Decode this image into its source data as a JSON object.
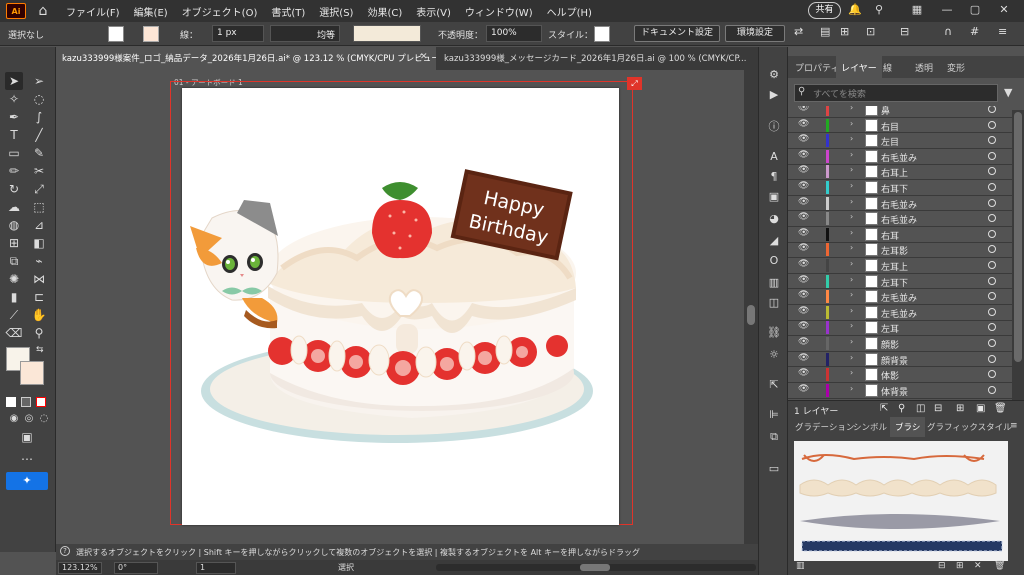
{
  "menubar": {
    "logo": "Ai",
    "items": [
      "ファイル(F)",
      "編集(E)",
      "オブジェクト(O)",
      "書式(T)",
      "選択(S)",
      "効果(C)",
      "表示(V)",
      "ウィンドウ(W)",
      "ヘルプ(H)"
    ],
    "share": "共有"
  },
  "control": {
    "selection": "選択なし",
    "stroke_label": "線：",
    "stroke_value": "1 px",
    "stroke_profile": "均等",
    "opacity_label": "不透明度：",
    "opacity_value": "100%",
    "style_label": "スタイル：",
    "doc_settings": "ドキュメント設定",
    "env_settings": "環境設定"
  },
  "tabs": [
    {
      "label": "kazu333999様案件_ロゴ_納品データ_2026年1月26日.ai* @ 123.12 % (CMYK/CPU プレビュー)",
      "active": true
    },
    {
      "label": "kazu333999様_メッセージカード_2026年1月26日.ai @ 100 % (CMYK/CP...",
      "active": false
    }
  ],
  "artboard": {
    "label": "01 - アートボード 1",
    "cake_text": [
      "Happy",
      "Birthday"
    ]
  },
  "status": {
    "hint": "選択するオブジェクトをクリック | Shift キーを押しながらクリックして複数のオブジェクトを選択 | 複製するオブジェクトを Alt キーを押しながらドラッグ"
  },
  "bottom": {
    "zoom": "123.12%",
    "angle": "0°",
    "artboard_num": "1",
    "mode": "選択"
  },
  "layers_panel": {
    "tabs": [
      "プロパティ",
      "レイヤー",
      "線",
      "透明",
      "変形"
    ],
    "active_tab": "レイヤー",
    "search_placeholder": "すべてを検索",
    "rows": [
      {
        "name": "鼻",
        "color": "#d44"
      },
      {
        "name": "右目",
        "color": "#2a2"
      },
      {
        "name": "左目",
        "color": "#33c"
      },
      {
        "name": "右毛並み",
        "color": "#c4c"
      },
      {
        "name": "右耳上",
        "color": "#c9c"
      },
      {
        "name": "右耳下",
        "color": "#3cc"
      },
      {
        "name": "右毛並み",
        "color": "#ccc"
      },
      {
        "name": "右毛並み",
        "color": "#888"
      },
      {
        "name": "右耳",
        "color": "#111"
      },
      {
        "name": "左耳影",
        "color": "#e63"
      },
      {
        "name": "左耳上",
        "color": "#444"
      },
      {
        "name": "左耳下",
        "color": "#3ca"
      },
      {
        "name": "左毛並み",
        "color": "#f84"
      },
      {
        "name": "左毛並み",
        "color": "#bb3"
      },
      {
        "name": "左耳",
        "color": "#93c"
      },
      {
        "name": "顔影",
        "color": "#666"
      },
      {
        "name": "顔背景",
        "color": "#226"
      },
      {
        "name": "体影",
        "color": "#c33"
      },
      {
        "name": "体背景",
        "color": "#a0a"
      }
    ],
    "footer": "1 レイヤー"
  },
  "brushes_panel": {
    "tabs": [
      "グラデーション",
      "シンボル",
      "ブラシ",
      "グラフィックスタイル"
    ],
    "active_tab": "ブラシ"
  }
}
